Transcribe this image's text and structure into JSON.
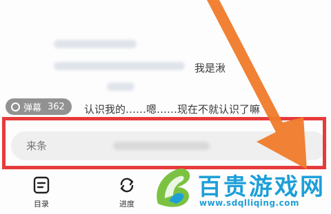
{
  "reader": {
    "visible_line_1": "我是湫",
    "visible_line_2": "认识我的……嗯……现在不就认识了嘛"
  },
  "danmaku": {
    "label": "弹幕",
    "count": "362"
  },
  "comment_input": {
    "placeholder": "来条"
  },
  "toolbar": {
    "items": [
      {
        "label": "目录",
        "icon": "catalog-icon"
      },
      {
        "label": "进度",
        "icon": "progress-icon"
      }
    ]
  },
  "watermark": {
    "title": "百贵游戏网",
    "url": "www.sdqlliqing.com"
  },
  "colors": {
    "highlight_frame": "#e63b3b",
    "arrow": "#f07a2a",
    "watermark_blue": "#1e9fd8",
    "watermark_green": "#7cc242"
  }
}
